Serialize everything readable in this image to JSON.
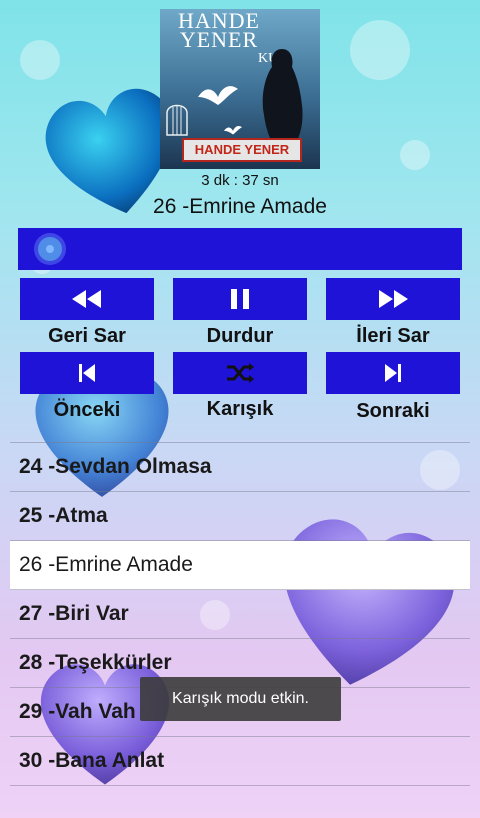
{
  "album": {
    "artist_top": "HANDE YENER",
    "subtitle": "KUŞ",
    "banner": "HANDE YENER"
  },
  "player": {
    "duration": "3 dk : 37 sn",
    "now_playing": "26 -Emrine Amade",
    "progress": 0.02
  },
  "controls": {
    "rewind": "Geri Sar",
    "pause": "Durdur",
    "forward": "İleri Sar",
    "previous": "Önceki",
    "shuffle": "Karışık",
    "next": "Sonraki"
  },
  "tracks": [
    {
      "label": "24 -Sevdan Olmasa"
    },
    {
      "label": "25 -Atma"
    },
    {
      "label": "26 -Emrine Amade",
      "selected": true
    },
    {
      "label": "27 -Biri Var"
    },
    {
      "label": "28 -Teşekkürler"
    },
    {
      "label": "29 -Vah Vah"
    },
    {
      "label": "30 -Bana Anlat"
    }
  ],
  "toast": "Karışık modu etkin.",
  "colors": {
    "button": "#1f13d8",
    "seek_thumb": "#4f8de8",
    "selected_row": "#ffffff"
  }
}
